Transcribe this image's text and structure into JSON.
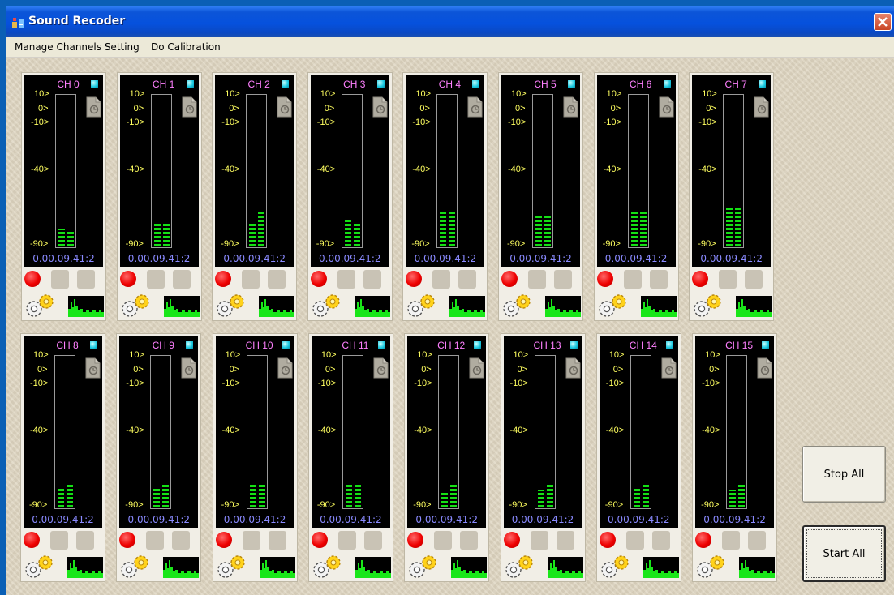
{
  "window": {
    "title": "Sound Recoder"
  },
  "menu": [
    "Manage Channels Setting",
    "Do Calibration"
  ],
  "scale_labels": [
    "10>",
    "0>",
    "-10>",
    "-40>",
    "-90>"
  ],
  "channels": [
    {
      "label": "CH 0",
      "time": "0.00.09.41:2",
      "levels": [
        0.12,
        0.1
      ]
    },
    {
      "label": "CH 1",
      "time": "0.00.09.41:2",
      "levels": [
        0.16,
        0.16
      ]
    },
    {
      "label": "CH 2",
      "time": "0.00.09.41:2",
      "levels": [
        0.16,
        0.23
      ]
    },
    {
      "label": "CH 3",
      "time": "0.00.09.41:2",
      "levels": [
        0.19,
        0.16
      ]
    },
    {
      "label": "CH 4",
      "time": "0.00.09.41:2",
      "levels": [
        0.23,
        0.23
      ]
    },
    {
      "label": "CH 5",
      "time": "0.00.09.41:2",
      "levels": [
        0.2,
        0.2
      ]
    },
    {
      "label": "CH 6",
      "time": "0.00.09.41:2",
      "levels": [
        0.23,
        0.23
      ]
    },
    {
      "label": "CH 7",
      "time": "0.00.09.41:2",
      "levels": [
        0.26,
        0.26
      ]
    },
    {
      "label": "CH 8",
      "time": "0.00.09.41:2",
      "levels": [
        0.13,
        0.16
      ]
    },
    {
      "label": "CH 9",
      "time": "0.00.09.41:2",
      "levels": [
        0.13,
        0.16
      ]
    },
    {
      "label": "CH 10",
      "time": "0.00.09.41:2",
      "levels": [
        0.16,
        0.16
      ]
    },
    {
      "label": "CH 11",
      "time": "0.00.09.41:2",
      "levels": [
        0.16,
        0.16
      ]
    },
    {
      "label": "CH 12",
      "time": "0.00.09.41:2",
      "levels": [
        0.1,
        0.16
      ]
    },
    {
      "label": "CH 13",
      "time": "0.00.09.41:2",
      "levels": [
        0.12,
        0.16
      ]
    },
    {
      "label": "CH 14",
      "time": "0.00.09.41:2",
      "levels": [
        0.13,
        0.16
      ]
    },
    {
      "label": "CH 15",
      "time": "0.00.09.41:2",
      "levels": [
        0.12,
        0.16
      ]
    }
  ],
  "buttons": {
    "stop_all": "Stop All",
    "start_all": "Start All"
  },
  "icons": {
    "app": "app-icon",
    "close": "close-icon",
    "record": "record-icon",
    "file": "document-icon",
    "settings": "gear-icon",
    "spectrum": "spectrum-icon",
    "led": "status-led-icon"
  },
  "colors": {
    "titlebar": "#0651dd",
    "meter_bg": "#000000",
    "level": "#14e014",
    "channel_label": "#ff80ff",
    "scale": "#ffff60",
    "time": "#8a8aff",
    "record": "#ee0000",
    "led": "#18c8e0"
  }
}
